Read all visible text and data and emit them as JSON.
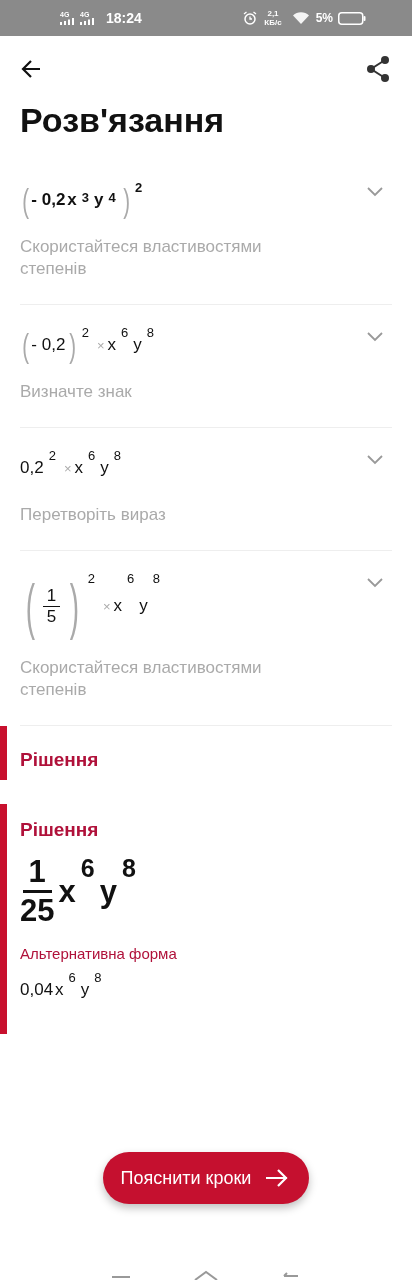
{
  "status_bar": {
    "network_1": "4G",
    "network_2": "4G",
    "time": "18:24",
    "speed": "2,1",
    "speed_unit": "КБ/с",
    "battery": "5%"
  },
  "header": {
    "title": "Розв'язання"
  },
  "steps": [
    {
      "bold": true,
      "expanded": false,
      "hint": "Скористайтеся властивостями степенів",
      "expression": [
        {
          "kind": "paren",
          "open": "(",
          "close": ")",
          "children": [
            {
              "kind": "text",
              "t": "- 0,2"
            },
            {
              "kind": "text",
              "t": "x"
            },
            {
              "kind": "sup",
              "t": "3"
            },
            {
              "kind": "text",
              "t": "y"
            },
            {
              "kind": "sup",
              "t": "4"
            }
          ]
        },
        {
          "kind": "sup",
          "t": "2"
        }
      ]
    },
    {
      "bold": false,
      "expanded": false,
      "hint": "Визначте знак",
      "expression": [
        {
          "kind": "paren",
          "open": "(",
          "close": ")",
          "children": [
            {
              "kind": "text",
              "t": "- 0,2"
            }
          ]
        },
        {
          "kind": "sup",
          "t": "2"
        },
        {
          "kind": "times",
          "t": "×"
        },
        {
          "kind": "text",
          "t": "x"
        },
        {
          "kind": "sup",
          "t": "6"
        },
        {
          "kind": "text",
          "t": "y"
        },
        {
          "kind": "sup",
          "t": "8"
        }
      ]
    },
    {
      "bold": false,
      "expanded": false,
      "hint": "Перетворіть вираз",
      "expression": [
        {
          "kind": "text",
          "t": "0,2"
        },
        {
          "kind": "sup",
          "t": "2"
        },
        {
          "kind": "times",
          "t": "×"
        },
        {
          "kind": "text",
          "t": "x"
        },
        {
          "kind": "sup",
          "t": "6"
        },
        {
          "kind": "text",
          "t": "y"
        },
        {
          "kind": "sup",
          "t": "8"
        }
      ]
    },
    {
      "bold": false,
      "expanded": false,
      "hint": "Скористайтеся властивостями степенів",
      "expression": [
        {
          "kind": "paren",
          "open": "(",
          "close": ")",
          "children": [
            {
              "kind": "frac",
              "num": "1",
              "den": "5"
            }
          ]
        },
        {
          "kind": "sup",
          "t": "2"
        },
        {
          "kind": "times",
          "t": "×"
        },
        {
          "kind": "text",
          "t": "x"
        },
        {
          "kind": "sup",
          "t": "6"
        },
        {
          "kind": "text",
          "t": "y"
        },
        {
          "kind": "sup",
          "t": "8"
        }
      ]
    }
  ],
  "solution_sections": [
    {
      "kind": "collapsed",
      "title": "Рішення"
    },
    {
      "kind": "result",
      "title": "Рішення",
      "answer": [
        {
          "kind": "frac",
          "num": "1",
          "den": "25"
        },
        {
          "kind": "text",
          "t": "x"
        },
        {
          "kind": "sup",
          "t": "6"
        },
        {
          "kind": "text",
          "t": "y"
        },
        {
          "kind": "sup",
          "t": "8"
        }
      ],
      "alt_label": "Альтернативна форма",
      "alt_answer": [
        {
          "kind": "text",
          "t": "0,04"
        },
        {
          "kind": "text",
          "t": "x"
        },
        {
          "kind": "sup",
          "t": "6"
        },
        {
          "kind": "text",
          "t": "y"
        },
        {
          "kind": "sup",
          "t": "8"
        }
      ]
    }
  ],
  "explain_button": {
    "label": "Пояснити кроки"
  }
}
